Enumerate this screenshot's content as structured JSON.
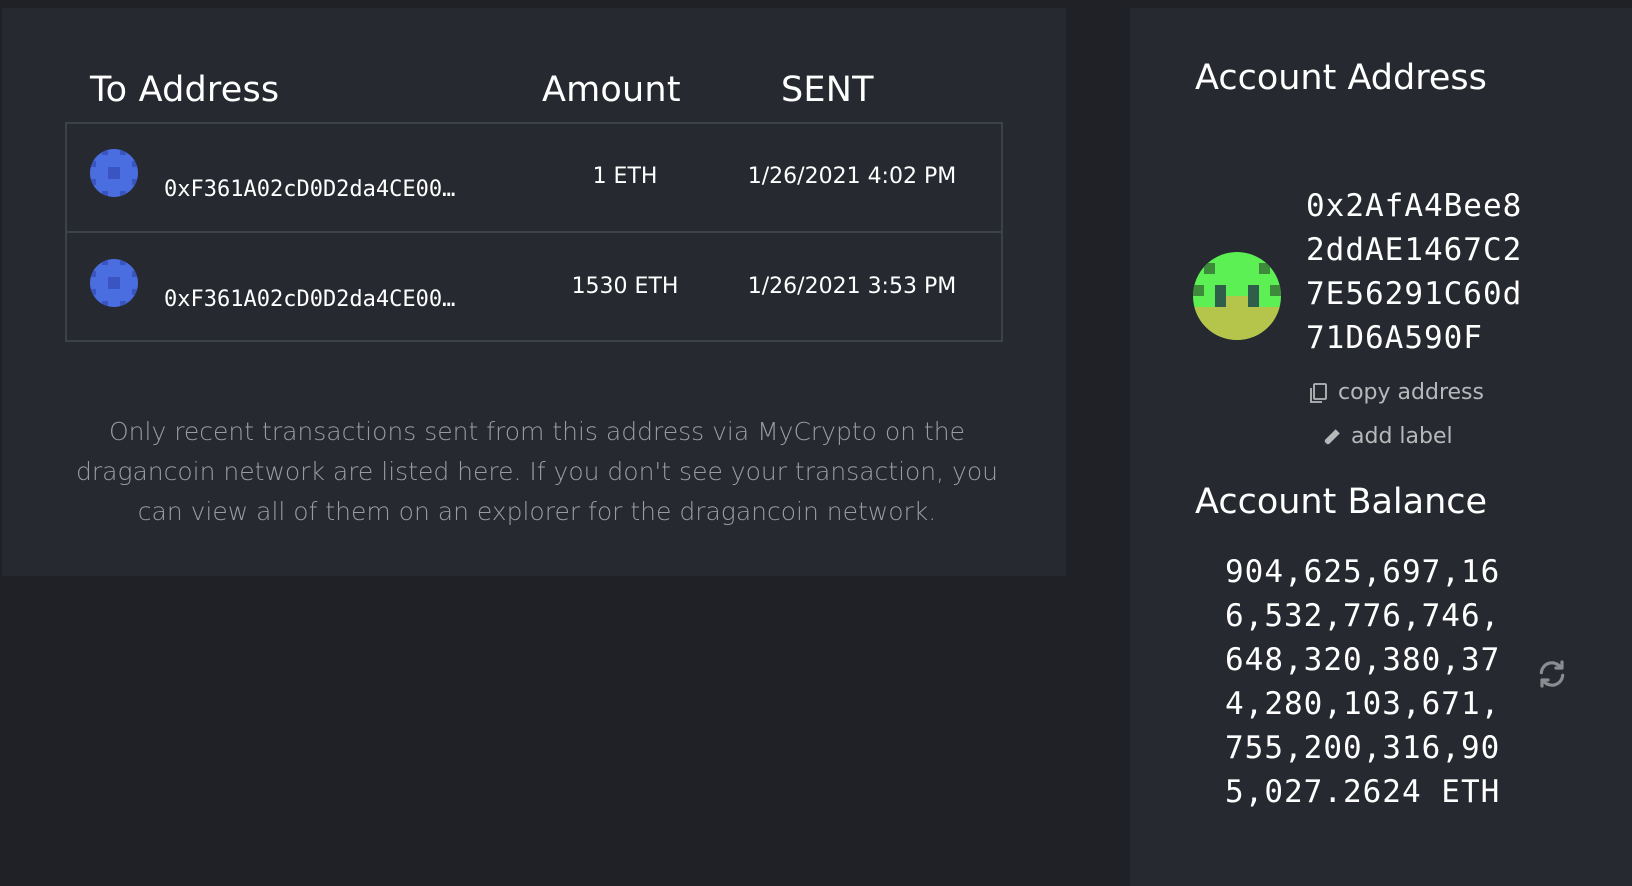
{
  "transactions": {
    "headers": {
      "to_address": "To Address",
      "amount": "Amount",
      "sent": "SENT"
    },
    "rows": [
      {
        "to_address": "0xF361A02cD0D2da4CE00…",
        "amount": "1 ETH",
        "sent": "1/26/2021 4:02 PM"
      },
      {
        "to_address": "0xF361A02cD0D2da4CE00…",
        "amount": "1530 ETH",
        "sent": "1/26/2021 3:53 PM"
      }
    ],
    "note": "Only recent transactions sent from this address via MyCrypto on the dragancoin network are listed here. If you don't see your transaction, you can view all of them on an explorer for the dragancoin network."
  },
  "account": {
    "address_title": "Account Address",
    "address": "0x2AfA4Bee82ddAE1467C27E56291C60d71D6A590F",
    "copy_label": "copy address",
    "add_label": "add label",
    "balance_title": "Account Balance",
    "balance": "904,625,697,166,532,776,746,648,320,380,374,280,103,671,755,200,316,905,027.2624 ETH"
  },
  "colors": {
    "panel": "#262a30",
    "background": "#1f2127",
    "tx_identicon": "#4a6ee0",
    "account_identicon_green": "#5cf055",
    "account_identicon_olive": "#b5c44a"
  },
  "icons": {
    "tx_identicon": "identicon",
    "account_identicon": "identicon",
    "copy": "copy-icon",
    "label": "pencil-icon",
    "refresh": "refresh-icon"
  }
}
